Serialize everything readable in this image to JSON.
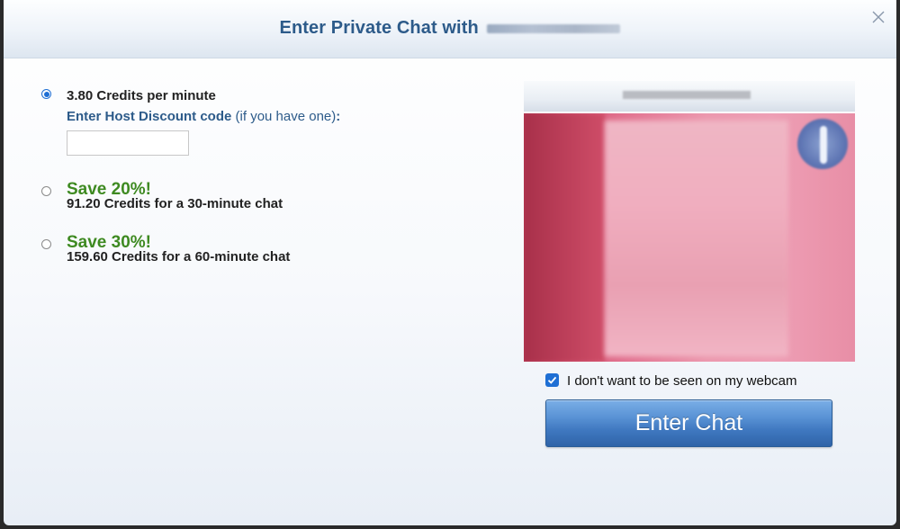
{
  "dialog": {
    "title": "Enter Private Chat with",
    "close_icon": "close-icon"
  },
  "options": {
    "per_minute": {
      "label": "3.80 Credits per minute",
      "selected": true
    },
    "discount": {
      "label_bold": "Enter Host Discount code",
      "label_rest": " (if you have one)",
      "colon": ":",
      "input_value": ""
    },
    "save20": {
      "title": "Save 20%!",
      "subtitle": "91.20 Credits for a 30-minute chat",
      "selected": false
    },
    "save30": {
      "title": "Save 30%!",
      "subtitle": "159.60 Credits for a 60-minute chat",
      "selected": false
    }
  },
  "preview": {
    "webcam_checkbox_checked": true,
    "webcam_label": "I don't want to be seen on my webcam"
  },
  "enter_button": {
    "label": "Enter Chat"
  },
  "colors": {
    "title": "#2d5b8a",
    "save_green": "#3e8a21",
    "button_blue": "#3f78c0",
    "radio_blue": "#1f6fd4"
  }
}
